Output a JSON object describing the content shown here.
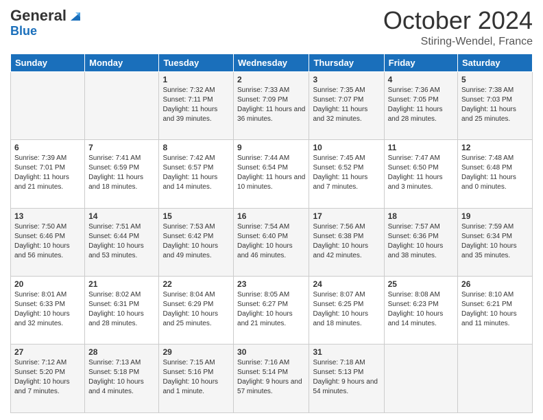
{
  "header": {
    "logo_general": "General",
    "logo_blue": "Blue",
    "month_title": "October 2024",
    "location": "Stiring-Wendel, France"
  },
  "days_of_week": [
    "Sunday",
    "Monday",
    "Tuesday",
    "Wednesday",
    "Thursday",
    "Friday",
    "Saturday"
  ],
  "weeks": [
    [
      {
        "day": "",
        "info": ""
      },
      {
        "day": "",
        "info": ""
      },
      {
        "day": "1",
        "info": "Sunrise: 7:32 AM\nSunset: 7:11 PM\nDaylight: 11 hours and 39 minutes."
      },
      {
        "day": "2",
        "info": "Sunrise: 7:33 AM\nSunset: 7:09 PM\nDaylight: 11 hours and 36 minutes."
      },
      {
        "day": "3",
        "info": "Sunrise: 7:35 AM\nSunset: 7:07 PM\nDaylight: 11 hours and 32 minutes."
      },
      {
        "day": "4",
        "info": "Sunrise: 7:36 AM\nSunset: 7:05 PM\nDaylight: 11 hours and 28 minutes."
      },
      {
        "day": "5",
        "info": "Sunrise: 7:38 AM\nSunset: 7:03 PM\nDaylight: 11 hours and 25 minutes."
      }
    ],
    [
      {
        "day": "6",
        "info": "Sunrise: 7:39 AM\nSunset: 7:01 PM\nDaylight: 11 hours and 21 minutes."
      },
      {
        "day": "7",
        "info": "Sunrise: 7:41 AM\nSunset: 6:59 PM\nDaylight: 11 hours and 18 minutes."
      },
      {
        "day": "8",
        "info": "Sunrise: 7:42 AM\nSunset: 6:57 PM\nDaylight: 11 hours and 14 minutes."
      },
      {
        "day": "9",
        "info": "Sunrise: 7:44 AM\nSunset: 6:54 PM\nDaylight: 11 hours and 10 minutes."
      },
      {
        "day": "10",
        "info": "Sunrise: 7:45 AM\nSunset: 6:52 PM\nDaylight: 11 hours and 7 minutes."
      },
      {
        "day": "11",
        "info": "Sunrise: 7:47 AM\nSunset: 6:50 PM\nDaylight: 11 hours and 3 minutes."
      },
      {
        "day": "12",
        "info": "Sunrise: 7:48 AM\nSunset: 6:48 PM\nDaylight: 11 hours and 0 minutes."
      }
    ],
    [
      {
        "day": "13",
        "info": "Sunrise: 7:50 AM\nSunset: 6:46 PM\nDaylight: 10 hours and 56 minutes."
      },
      {
        "day": "14",
        "info": "Sunrise: 7:51 AM\nSunset: 6:44 PM\nDaylight: 10 hours and 53 minutes."
      },
      {
        "day": "15",
        "info": "Sunrise: 7:53 AM\nSunset: 6:42 PM\nDaylight: 10 hours and 49 minutes."
      },
      {
        "day": "16",
        "info": "Sunrise: 7:54 AM\nSunset: 6:40 PM\nDaylight: 10 hours and 46 minutes."
      },
      {
        "day": "17",
        "info": "Sunrise: 7:56 AM\nSunset: 6:38 PM\nDaylight: 10 hours and 42 minutes."
      },
      {
        "day": "18",
        "info": "Sunrise: 7:57 AM\nSunset: 6:36 PM\nDaylight: 10 hours and 38 minutes."
      },
      {
        "day": "19",
        "info": "Sunrise: 7:59 AM\nSunset: 6:34 PM\nDaylight: 10 hours and 35 minutes."
      }
    ],
    [
      {
        "day": "20",
        "info": "Sunrise: 8:01 AM\nSunset: 6:33 PM\nDaylight: 10 hours and 32 minutes."
      },
      {
        "day": "21",
        "info": "Sunrise: 8:02 AM\nSunset: 6:31 PM\nDaylight: 10 hours and 28 minutes."
      },
      {
        "day": "22",
        "info": "Sunrise: 8:04 AM\nSunset: 6:29 PM\nDaylight: 10 hours and 25 minutes."
      },
      {
        "day": "23",
        "info": "Sunrise: 8:05 AM\nSunset: 6:27 PM\nDaylight: 10 hours and 21 minutes."
      },
      {
        "day": "24",
        "info": "Sunrise: 8:07 AM\nSunset: 6:25 PM\nDaylight: 10 hours and 18 minutes."
      },
      {
        "day": "25",
        "info": "Sunrise: 8:08 AM\nSunset: 6:23 PM\nDaylight: 10 hours and 14 minutes."
      },
      {
        "day": "26",
        "info": "Sunrise: 8:10 AM\nSunset: 6:21 PM\nDaylight: 10 hours and 11 minutes."
      }
    ],
    [
      {
        "day": "27",
        "info": "Sunrise: 7:12 AM\nSunset: 5:20 PM\nDaylight: 10 hours and 7 minutes."
      },
      {
        "day": "28",
        "info": "Sunrise: 7:13 AM\nSunset: 5:18 PM\nDaylight: 10 hours and 4 minutes."
      },
      {
        "day": "29",
        "info": "Sunrise: 7:15 AM\nSunset: 5:16 PM\nDaylight: 10 hours and 1 minute."
      },
      {
        "day": "30",
        "info": "Sunrise: 7:16 AM\nSunset: 5:14 PM\nDaylight: 9 hours and 57 minutes."
      },
      {
        "day": "31",
        "info": "Sunrise: 7:18 AM\nSunset: 5:13 PM\nDaylight: 9 hours and 54 minutes."
      },
      {
        "day": "",
        "info": ""
      },
      {
        "day": "",
        "info": ""
      }
    ]
  ]
}
